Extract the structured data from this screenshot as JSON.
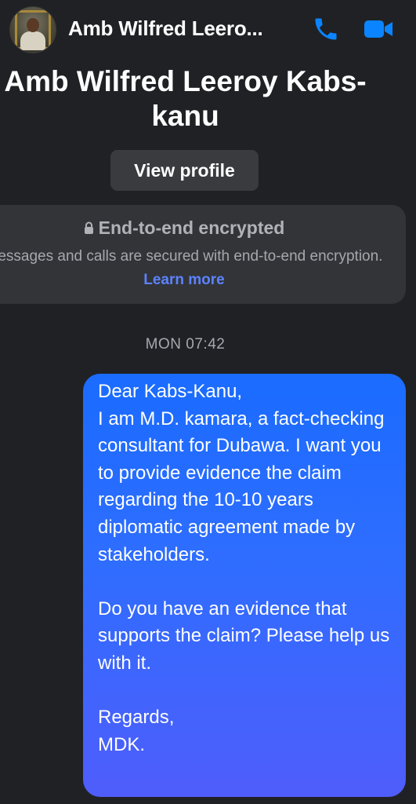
{
  "header": {
    "title": "Amb Wilfred Leero...",
    "avatar_icon": "profile-photo",
    "call_icon": "phone-icon",
    "video_icon": "video-camera-icon",
    "accent_color": "#0a84ff"
  },
  "profile": {
    "name": "Amb Wilfred Leeroy Kabs-kanu",
    "view_profile_label": "View profile"
  },
  "encryption": {
    "icon": "lock-icon",
    "title": "End-to-end encrypted",
    "description": "Messages and calls are secured with end-to-end encryption.",
    "learn_more": "Learn more"
  },
  "conversation": {
    "timestamp": "MON 07:42",
    "messages": [
      {
        "direction": "outgoing",
        "text": "Dear Kabs-Kanu,\nI am M.D. kamara, a fact-checking consultant for Dubawa. I want you to provide evidence the claim regarding the 10-10 years diplomatic agreement made by stakeholders.\n\nDo you have an evidence that supports the claim? Please help us with it.\n\nRegards,\nMDK."
      }
    ]
  }
}
